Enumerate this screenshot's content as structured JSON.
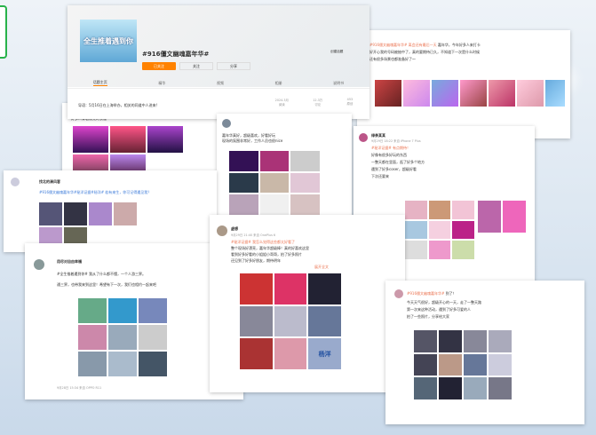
{
  "topic": {
    "logo_text": "全生推着遇到你",
    "title": "#916僵文幽魂嘉年华#",
    "follow_btn": "已关注",
    "follow2_btn": "关注",
    "share_btn": "分享",
    "post_btn": "创建话题",
    "tabs": [
      "话题主页",
      "精华",
      "视频",
      "相册",
      "说明书"
    ],
    "desc": "导语：5月16日在上海举办，相关的同道中人进来!",
    "stats": [
      "2024.3月",
      "12.3万",
      "453"
    ],
    "stat_labels": [
      "阅读",
      "讨论",
      "原创"
    ]
  },
  "posts": {
    "p1_tag": "#916僵文幽魂嘉年华# 离会还有最后一天",
    "p2_text": "#916僵文幽魂嘉年华#秘洋证据#秘洋# 若有来生，你可记得遇见我？",
    "p2_name": "找北的清风客",
    "p3_name": "用尽对自由幸福",
    "p3_text": "#全生推着遇到你# 我从了什么都不懂，一个人游三界。",
    "p3_text2": "通三界，也带我来到这里！希望有下一次，我们也相约一起来吧",
    "p3_time": "9月28日 15:34 来自 OPPO R11",
    "p4_name": "绿茶某某",
    "p4_text": "#秘洋证据# 有点期待！",
    "p4_time": "9月29日 18:22 来自 iPhone 7 Plus",
    "p5_name": "虚想",
    "p5_text": "#秘洋证据# 我怎么觉得这些都太好看了",
    "p5_time": "9月29日 21:40 来自 OnePlus 6",
    "p5_more": "展开全文",
    "p6_tag": "#916僵文幽魂嘉年华#",
    "p7_tag": "#916僵文幽魂嘉年华#",
    "sign": "杨洋"
  },
  "colors": {
    "accent": "#eb7350",
    "tag": "#3b7ad9",
    "follow": "#ff8200"
  }
}
